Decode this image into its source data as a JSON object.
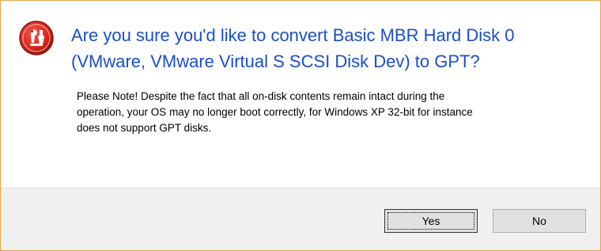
{
  "dialog": {
    "heading_lines": [
      "Are you sure you'd like to convert Basic MBR Hard Disk 0",
      "(VMware, VMware Virtual S SCSI Disk Dev) to GPT?"
    ],
    "note_lines": [
      "Please Note! Despite the fact that all on-disk contents remain intact during the",
      "operation, your OS may no longer boot correctly, for Windows XP 32-bit for instance",
      "does not support GPT disks."
    ],
    "icon": "app-logo-icon",
    "buttons": {
      "yes_label": "Yes",
      "no_label": "No"
    }
  },
  "colors": {
    "heading": "#1a4ec9",
    "icon_red": "#d9261c",
    "border": "#e3a64a",
    "footer_bg": "#f0f0f0"
  }
}
